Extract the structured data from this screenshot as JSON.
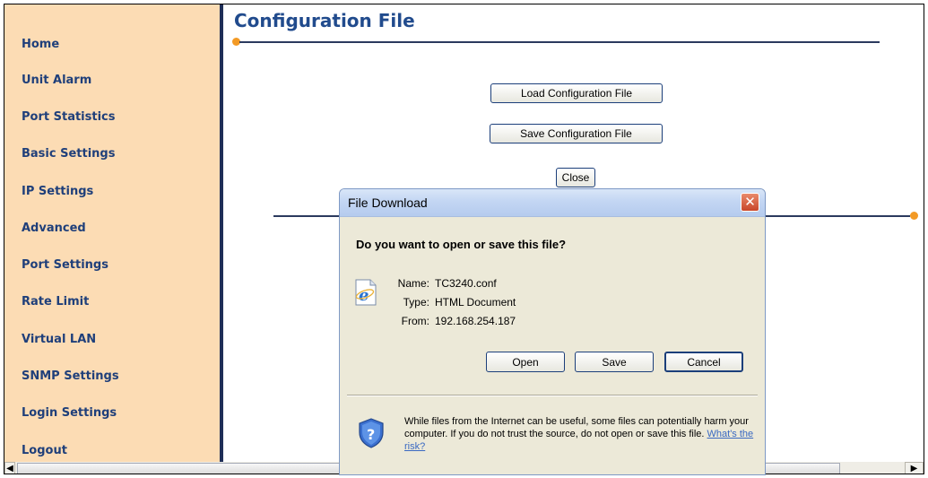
{
  "sidebar": {
    "items": [
      {
        "label": "Home"
      },
      {
        "label": "Unit Alarm"
      },
      {
        "label": "Port Statistics"
      },
      {
        "label": "Basic Settings"
      },
      {
        "label": "IP Settings"
      },
      {
        "label": "Advanced"
      },
      {
        "label": "Port Settings"
      },
      {
        "label": "Rate Limit"
      },
      {
        "label": "Virtual LAN"
      },
      {
        "label": "SNMP Settings"
      },
      {
        "label": "Login Settings"
      },
      {
        "label": "Logout"
      }
    ]
  },
  "main": {
    "title": "Configuration File",
    "load_button": "Load Configuration File",
    "save_button": "Save Configuration File",
    "close_button": "Close"
  },
  "dialog": {
    "title": "File Download",
    "question": "Do you want to open or save this file?",
    "name_label": "Name:",
    "name_value": "TC3240.conf",
    "type_label": "Type:",
    "type_value": "HTML Document",
    "from_label": "From:",
    "from_value": "192.168.254.187",
    "open_button": "Open",
    "save_button": "Save",
    "cancel_button": "Cancel",
    "warning_text": "While files from the Internet can be useful, some files can potentially harm your computer. If you do not trust the source, do not open or save this file.",
    "risk_link": "What's the risk?"
  },
  "colors": {
    "sidebar_bg": "#fcdcb4",
    "title_color": "#214b8d",
    "accent_dot": "#f39a25"
  },
  "icons": {
    "file": "ie-document-icon",
    "warning": "security-shield-icon",
    "close": "close-icon"
  }
}
